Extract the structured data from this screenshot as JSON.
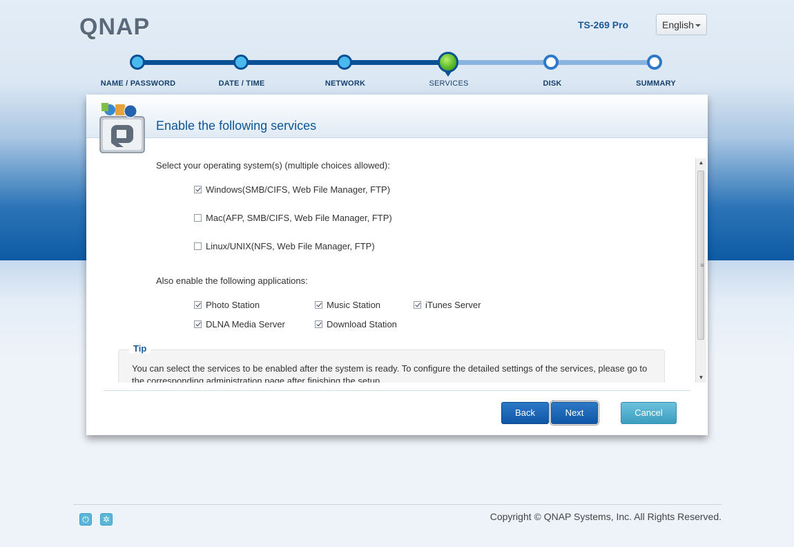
{
  "header": {
    "logo": "QNAP",
    "model": "TS-269 Pro",
    "language": "English"
  },
  "steps": [
    {
      "label": "NAME / PASSWORD",
      "state": "done"
    },
    {
      "label": "DATE / TIME",
      "state": "done"
    },
    {
      "label": "NETWORK",
      "state": "done"
    },
    {
      "label": "SERVICES",
      "state": "current"
    },
    {
      "label": "DISK",
      "state": "todo"
    },
    {
      "label": "SUMMARY",
      "state": "todo"
    }
  ],
  "panel": {
    "title": "Enable the following services",
    "os_prompt": "Select your operating system(s) (multiple choices allowed):",
    "os_options": [
      {
        "label": "Windows(SMB/CIFS, Web File Manager, FTP)",
        "checked": true
      },
      {
        "label": "Mac(AFP, SMB/CIFS, Web File Manager, FTP)",
        "checked": false
      },
      {
        "label": "Linux/UNIX(NFS, Web File Manager, FTP)",
        "checked": false
      }
    ],
    "apps_prompt": "Also enable the following applications:",
    "apps": [
      {
        "label": "Photo Station",
        "checked": true
      },
      {
        "label": "Music Station",
        "checked": true
      },
      {
        "label": "iTunes Server",
        "checked": true
      },
      {
        "label": "DLNA Media Server",
        "checked": true
      },
      {
        "label": "Download Station",
        "checked": true
      }
    ],
    "tip_title": "Tip",
    "tip_text": "You can select the services to be enabled after the system is ready. To configure the detailed settings of the services, please go to the corresponding administration page after finishing the setup."
  },
  "buttons": {
    "back": "Back",
    "next": "Next",
    "cancel": "Cancel"
  },
  "footer": {
    "copyright": "Copyright © QNAP Systems, Inc. All Rights Reserved.",
    "icons": [
      "power-icon",
      "settings-icon"
    ]
  },
  "colors": {
    "brand_blue": "#0b4f94",
    "accent_green": "#5bb92a",
    "cancel_teal": "#3c9dc0"
  }
}
